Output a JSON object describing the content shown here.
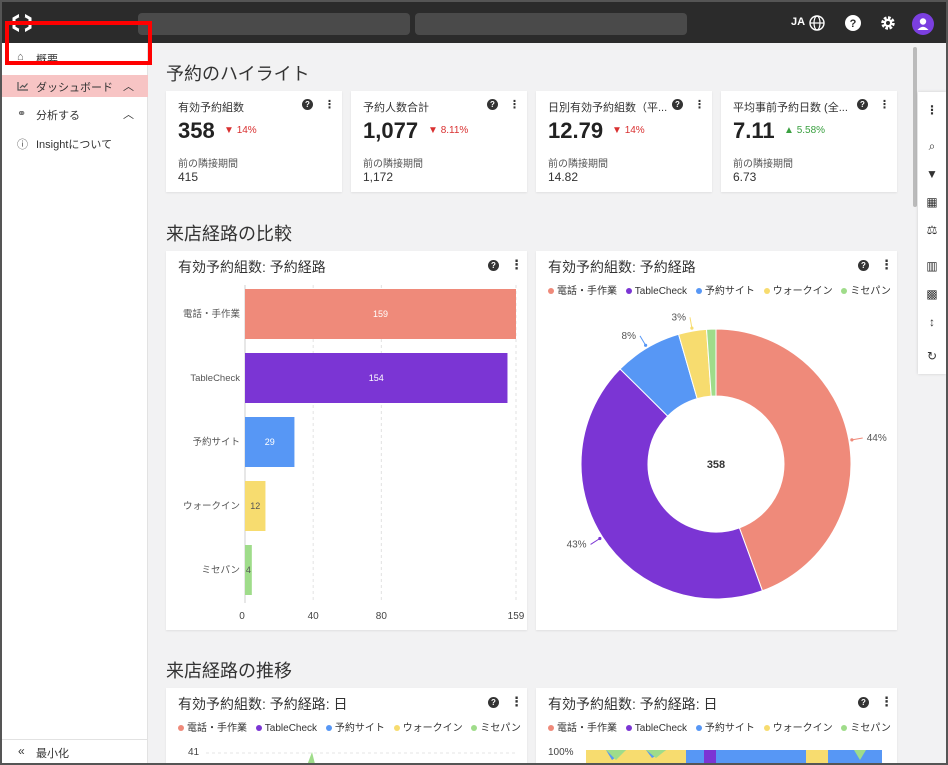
{
  "topbar": {
    "lang": "JA"
  },
  "sidebar": {
    "items": [
      {
        "label": "概要"
      },
      {
        "label": "ダッシュボード"
      },
      {
        "label": "分析する"
      },
      {
        "label": "Insightについて"
      }
    ],
    "minimize": "最小化"
  },
  "sections": {
    "highlights": "予約のハイライト",
    "compare": "来店経路の比較",
    "trend": "来店経路の推移"
  },
  "kpis": [
    {
      "title": "有効予約組数",
      "value": "358",
      "delta": "14%",
      "dir": "down",
      "prev_label": "前の隣接期間",
      "prev_value": "415"
    },
    {
      "title": "予約人数合計",
      "value": "1,077",
      "delta": "8.11%",
      "dir": "down",
      "prev_label": "前の隣接期間",
      "prev_value": "1,172"
    },
    {
      "title": "日別有効予約組数（平...",
      "value": "12.79",
      "delta": "14%",
      "dir": "down",
      "prev_label": "前の隣接期間",
      "prev_value": "14.82"
    },
    {
      "title": "平均事前予約日数 (全...",
      "value": "7.11",
      "delta": "5.58%",
      "dir": "up",
      "prev_label": "前の隣接期間",
      "prev_value": "6.73"
    }
  ],
  "colors": {
    "phone": "#ef8a7a",
    "tablecheck": "#7b35d4",
    "site": "#5797f5",
    "walkin": "#f7dc6f",
    "misepan": "#9fdc8a",
    "highlight": "#ff0000"
  },
  "legend": [
    "電話・手作業",
    "TableCheck",
    "予約サイト",
    "ウォークイン",
    "ミセパン"
  ],
  "bar_card": {
    "title": "有効予約組数: 予約経路"
  },
  "donut_card": {
    "title": "有効予約組数: 予約経路"
  },
  "trend_left": {
    "title": "有効予約組数: 予約経路: 日",
    "y_top": "41"
  },
  "trend_right": {
    "title": "有効予約組数: 予約経路: 日",
    "y_top": "100%"
  },
  "chart_data": [
    {
      "type": "bar",
      "title": "有効予約組数: 予約経路",
      "categories": [
        "電話・手作業",
        "TableCheck",
        "予約サイト",
        "ウォークイン",
        "ミセパン"
      ],
      "values": [
        159,
        154,
        29,
        12,
        4
      ],
      "x_ticks": [
        "0",
        "40",
        "80",
        "159"
      ],
      "xlim": [
        0,
        159
      ],
      "grid": true
    },
    {
      "type": "pie",
      "title": "有効予約組数: 予約経路",
      "categories": [
        "電話・手作業",
        "TableCheck",
        "予約サイト",
        "ウォークイン",
        "ミセパン"
      ],
      "values": [
        159,
        154,
        29,
        12,
        4
      ],
      "labels": [
        "44%",
        "43%",
        "8%",
        "3%",
        ""
      ],
      "center_label": "358",
      "legend": "top"
    }
  ]
}
